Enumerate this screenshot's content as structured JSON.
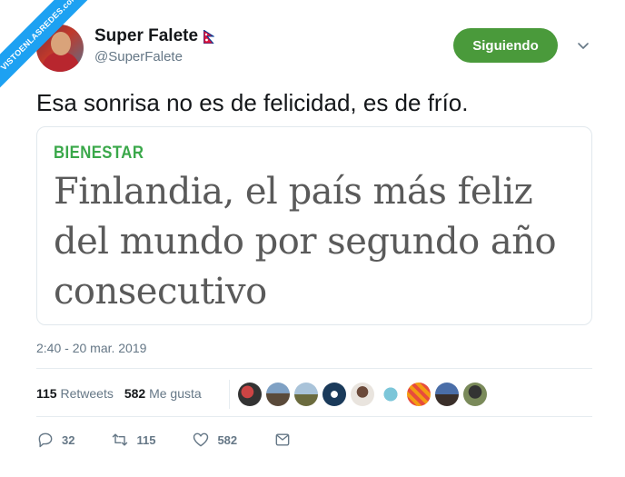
{
  "watermark": "VISTOENLASREDES.com",
  "user": {
    "name": "Super Falete",
    "handle": "@SuperFalete"
  },
  "follow_button": "Siguiendo",
  "tweet": {
    "text": "Esa sonrisa no es de felicidad, es de frío.",
    "timestamp": "2:40 - 20 mar. 2019"
  },
  "card": {
    "section": "BIENESTAR",
    "headline": "Finlandia, el país más feliz del mundo por segundo año consecutivo"
  },
  "stats": {
    "retweets_count": "115",
    "retweets_label": "Retweets",
    "likes_count": "582",
    "likes_label": "Me gusta"
  },
  "actions": {
    "reply_count": "32",
    "retweet_count": "115",
    "like_count": "582"
  },
  "colors": {
    "follow_green": "#4a9a3b",
    "section_green": "#3aa84a",
    "watermark_blue": "#1da1f2"
  }
}
